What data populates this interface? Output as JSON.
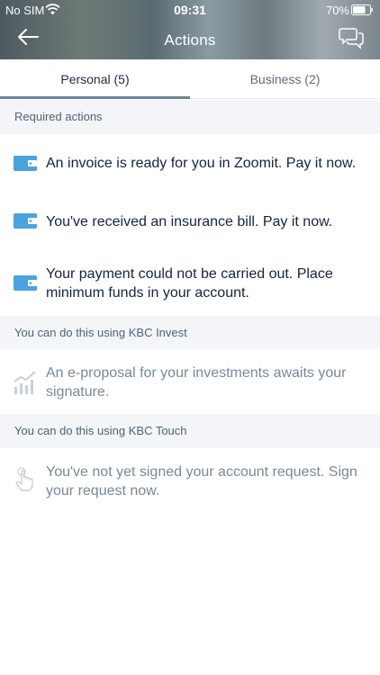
{
  "status": {
    "carrier": "No SIM",
    "time": "09:31",
    "battery": "70%"
  },
  "header": {
    "title": "Actions"
  },
  "tabs": [
    {
      "label": "Personal (5)"
    },
    {
      "label": "Business (2)"
    }
  ],
  "sections": [
    {
      "title": "Required actions",
      "items": [
        {
          "text": "An invoice is ready for you in Zoomit. Pay it now.",
          "icon": "wallet-icon"
        },
        {
          "text": "You've received an insurance bill. Pay it now.",
          "icon": "wallet-icon"
        },
        {
          "text": "Your payment could not be carried out. Place minimum funds in your account.",
          "icon": "wallet-icon"
        }
      ]
    },
    {
      "title": "You can do this using KBC Invest",
      "items": [
        {
          "text": "An e-proposal for your investments awaits your signature.",
          "icon": "investment-chart-icon"
        }
      ]
    },
    {
      "title": "You can do this using KBC Touch",
      "items": [
        {
          "text": "You've not yet signed your account request. Sign your request now.",
          "icon": "touch-hand-icon"
        }
      ]
    }
  ],
  "colors": {
    "accent": "#4aa3e0",
    "tab_indicator": "#6f8193",
    "section_bg": "#f3f5f8"
  }
}
